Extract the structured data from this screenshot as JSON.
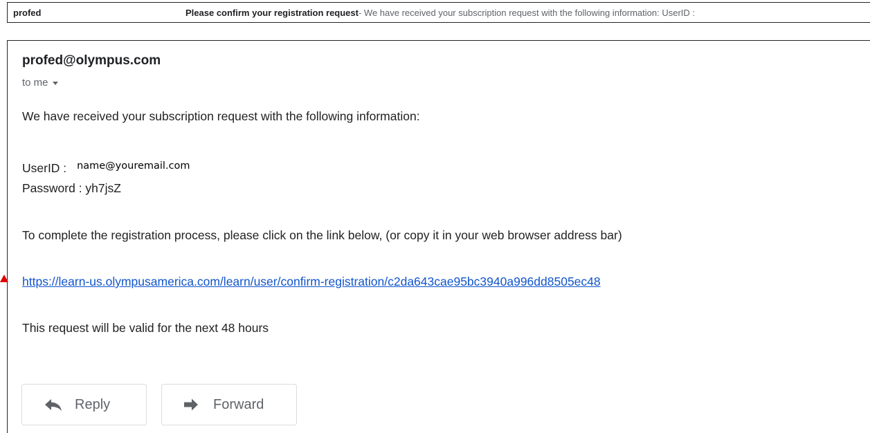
{
  "inbox_row": {
    "sender": "profed",
    "subject": "Please confirm your registration request",
    "snippet": " - We have received your subscription request with the following information: UserID :"
  },
  "email": {
    "from": "profed@olympus.com",
    "to": "to me",
    "intro": "We have received your subscription request with the following information:",
    "userid_label": "UserID :",
    "userid_value": "name@youremail.com",
    "password_line": "Password : yh7jsZ",
    "instruction": "To complete the registration process, please click on the link below, (or copy it in your web browser address bar)",
    "link": "https://learn-us.olympusamerica.com/learn/user/confirm-registration/c2da643cae95bc3940a996dd8505ec48",
    "validity": "This request will be valid for the next 48 hours"
  },
  "actions": {
    "reply_label": "Reply",
    "forward_label": "Forward",
    "reply_icon": "reply-arrow-icon",
    "forward_icon": "forward-arrow-icon"
  },
  "colors": {
    "link": "#1155cc",
    "annotation": "#e00000",
    "muted": "#5f6368"
  }
}
